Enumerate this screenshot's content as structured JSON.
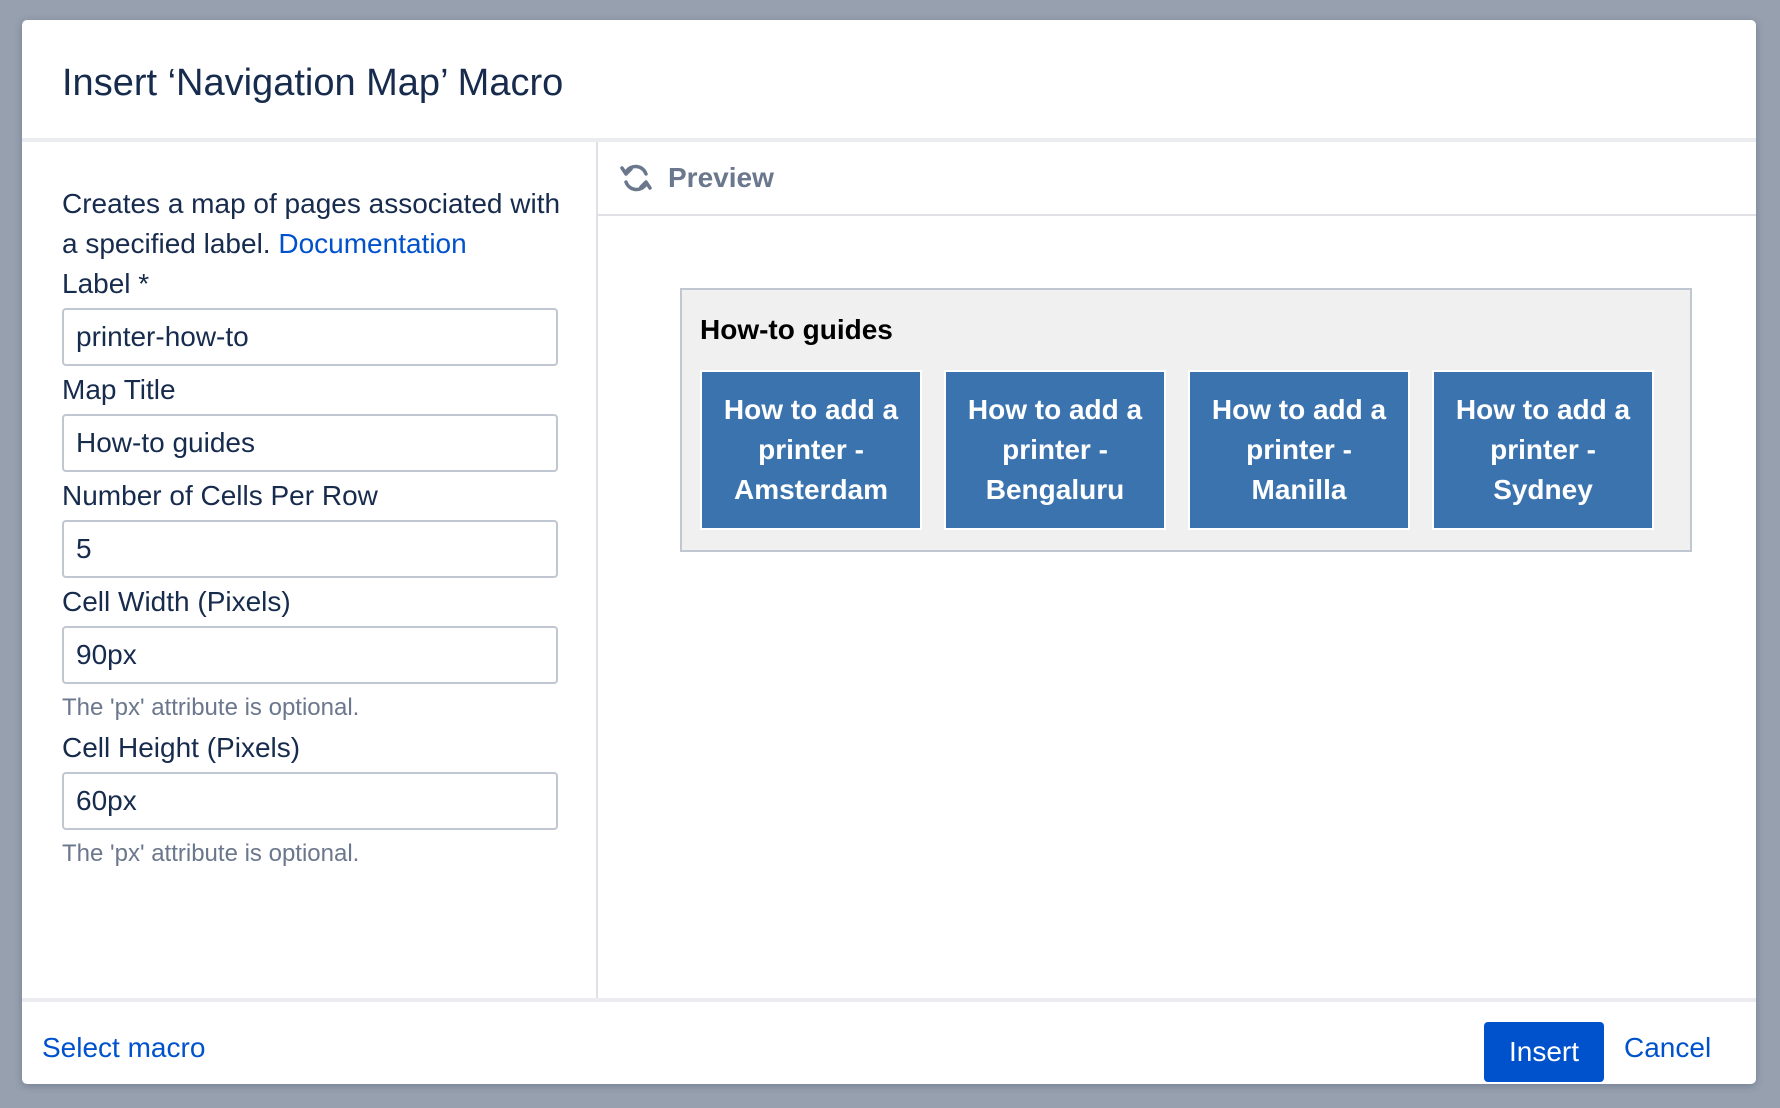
{
  "dialog": {
    "title": "Insert ‘Navigation Map’ Macro"
  },
  "form": {
    "description_text": "Creates a map of pages associated with a specified label.",
    "documentation_link": "Documentation",
    "fields": {
      "label": {
        "label": "Label *",
        "value": "printer-how-to"
      },
      "map_title": {
        "label": "Map Title",
        "value": "How-to guides"
      },
      "cells_per_row": {
        "label": "Number of Cells Per Row",
        "value": "5"
      },
      "cell_width": {
        "label": "Cell Width (Pixels)",
        "value": "90px",
        "hint": "The 'px' attribute is optional."
      },
      "cell_height": {
        "label": "Cell Height (Pixels)",
        "value": "60px",
        "hint": "The 'px' attribute is optional."
      }
    }
  },
  "preview": {
    "label": "Preview",
    "refresh_icon": "refresh-icon",
    "map_title": "How-to guides",
    "cells": [
      {
        "text": "How to add a printer - Amsterdam"
      },
      {
        "text": "How to add a printer - Bengaluru"
      },
      {
        "text": "How to add a printer - Manilla"
      },
      {
        "text": "How to add a printer - Sydney"
      }
    ],
    "colors": {
      "cell_bg": "#3b73af",
      "map_bg": "#f0f0f0"
    }
  },
  "footer": {
    "select_macro": "Select macro",
    "insert": "Insert",
    "cancel": "Cancel"
  },
  "colors": {
    "backdrop": "#97a0af",
    "primary": "#0052cc",
    "text": "#172b4d",
    "muted": "#6b778c"
  }
}
